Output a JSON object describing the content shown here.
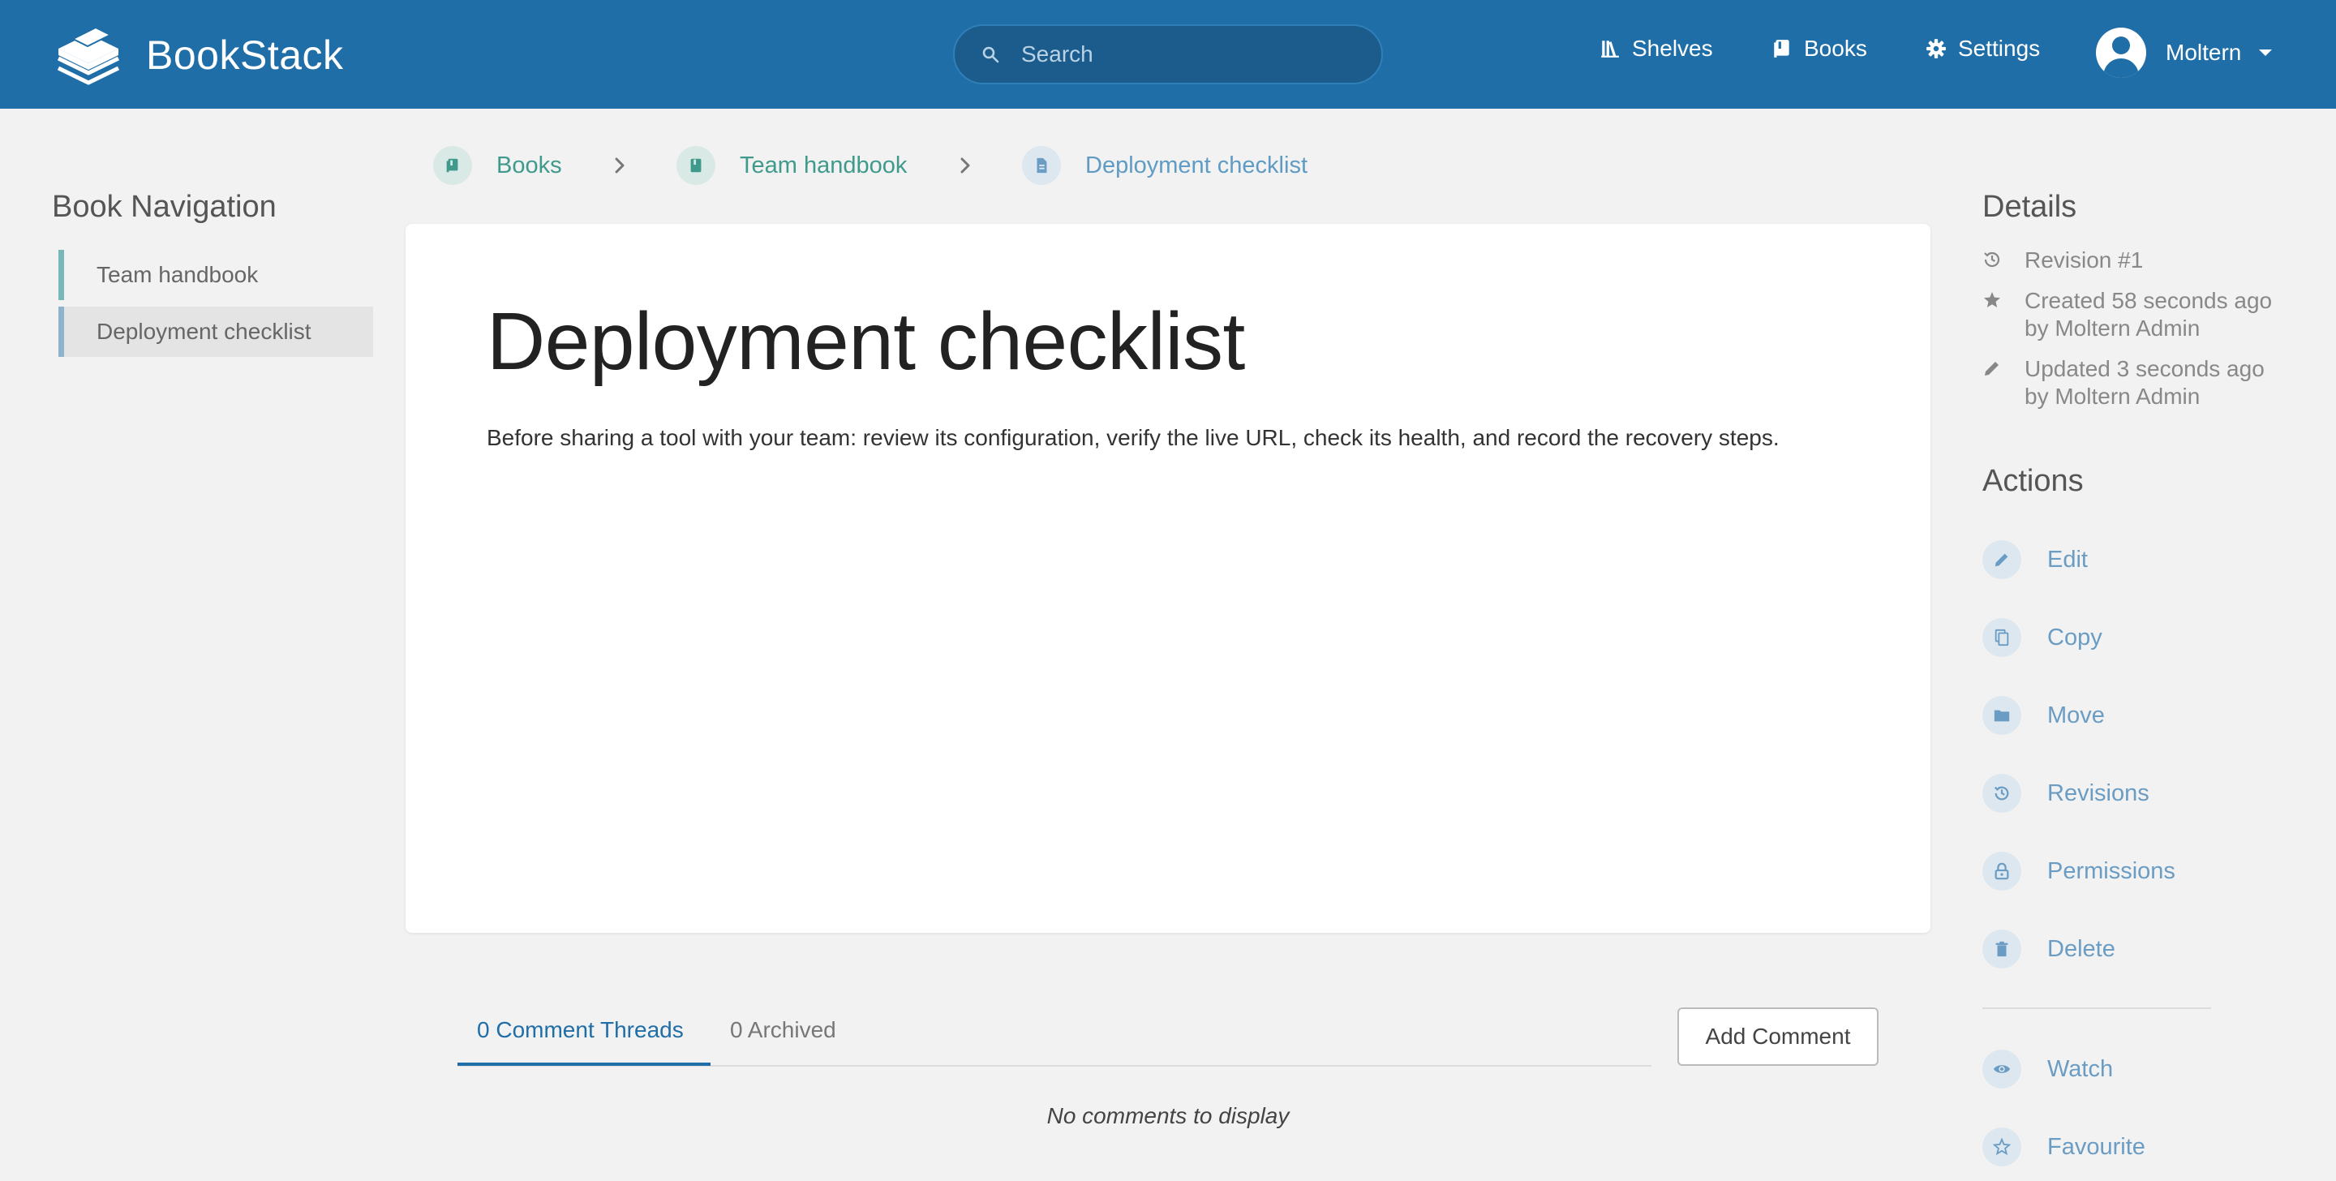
{
  "header": {
    "app_name": "BookStack",
    "search_placeholder": "Search",
    "nav": {
      "shelves": "Shelves",
      "books": "Books",
      "settings": "Settings"
    },
    "user_name": "Moltern"
  },
  "left_nav": {
    "title": "Book Navigation",
    "items": [
      "Team handbook",
      "Deployment checklist"
    ]
  },
  "breadcrumb": [
    "Books",
    "Team handbook",
    "Deployment checklist"
  ],
  "page": {
    "title": "Deployment checklist",
    "body": "Before sharing a tool with your team: review its configuration, verify the live URL, check its health, and record the recovery steps."
  },
  "comments": {
    "tab_threads": "0 Comment Threads",
    "tab_archived": "0 Archived",
    "add_button": "Add Comment",
    "empty_text": "No comments to display"
  },
  "details": {
    "title": "Details",
    "revision": "Revision #1",
    "created_line1": "Created 58 seconds ago",
    "created_line2": "by Moltern Admin",
    "updated_line1": "Updated 3 seconds ago",
    "updated_line2": "by Moltern Admin"
  },
  "actions": {
    "title": "Actions",
    "edit": "Edit",
    "copy": "Copy",
    "move": "Move",
    "revisions": "Revisions",
    "permissions": "Permissions",
    "delete": "Delete",
    "watch": "Watch",
    "favourite": "Favourite"
  },
  "colors": {
    "header_bg": "#206ea7",
    "link_teal": "#3f9a8c",
    "link_blue": "#6a9cc4"
  }
}
